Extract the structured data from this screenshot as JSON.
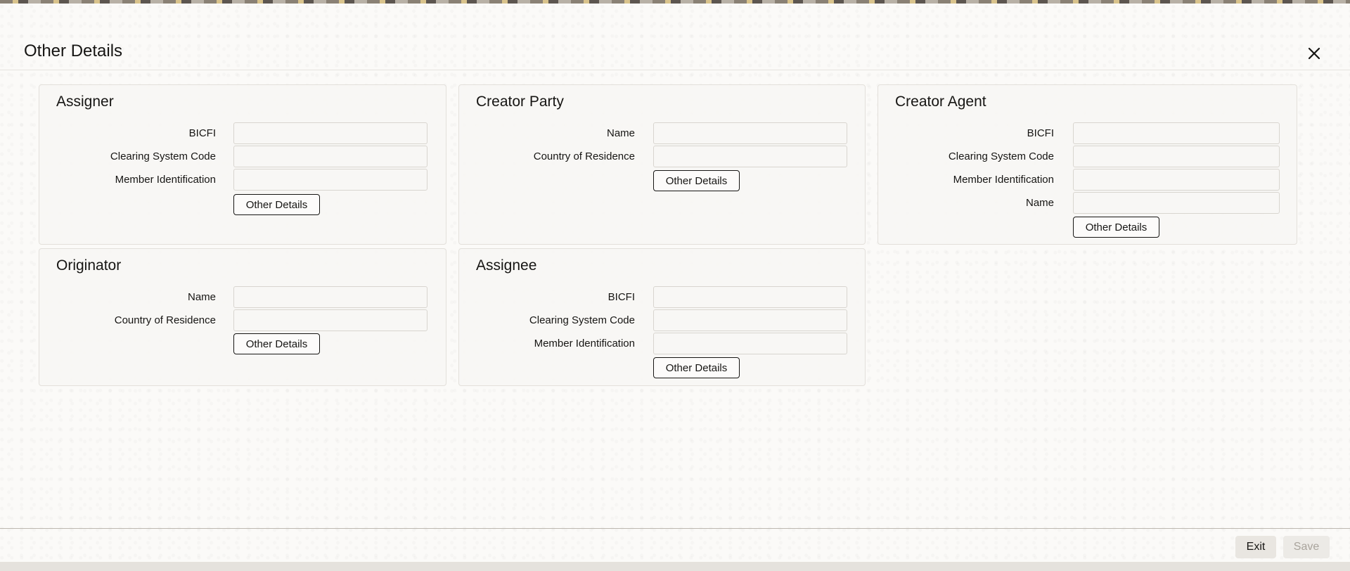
{
  "dialog": {
    "title": "Other Details",
    "close_icon": "close-icon"
  },
  "panels": {
    "assigner": {
      "title": "Assigner",
      "fields": [
        {
          "label": "BICFI",
          "value": ""
        },
        {
          "label": "Clearing System Code",
          "value": ""
        },
        {
          "label": "Member Identification",
          "value": ""
        }
      ],
      "button_label": "Other Details"
    },
    "creator_party": {
      "title": "Creator Party",
      "fields": [
        {
          "label": "Name",
          "value": ""
        },
        {
          "label": "Country of Residence",
          "value": ""
        }
      ],
      "button_label": "Other Details"
    },
    "creator_agent": {
      "title": "Creator Agent",
      "fields": [
        {
          "label": "BICFI",
          "value": ""
        },
        {
          "label": "Clearing System Code",
          "value": ""
        },
        {
          "label": "Member Identification",
          "value": ""
        },
        {
          "label": "Name",
          "value": ""
        }
      ],
      "button_label": "Other Details"
    },
    "originator": {
      "title": "Originator",
      "fields": [
        {
          "label": "Name",
          "value": ""
        },
        {
          "label": "Country of Residence",
          "value": ""
        }
      ],
      "button_label": "Other Details"
    },
    "assignee": {
      "title": "Assignee",
      "fields": [
        {
          "label": "BICFI",
          "value": ""
        },
        {
          "label": "Clearing System Code",
          "value": ""
        },
        {
          "label": "Member Identification",
          "value": ""
        }
      ],
      "button_label": "Other Details"
    }
  },
  "footer": {
    "exit_label": "Exit",
    "save_label": "Save"
  }
}
